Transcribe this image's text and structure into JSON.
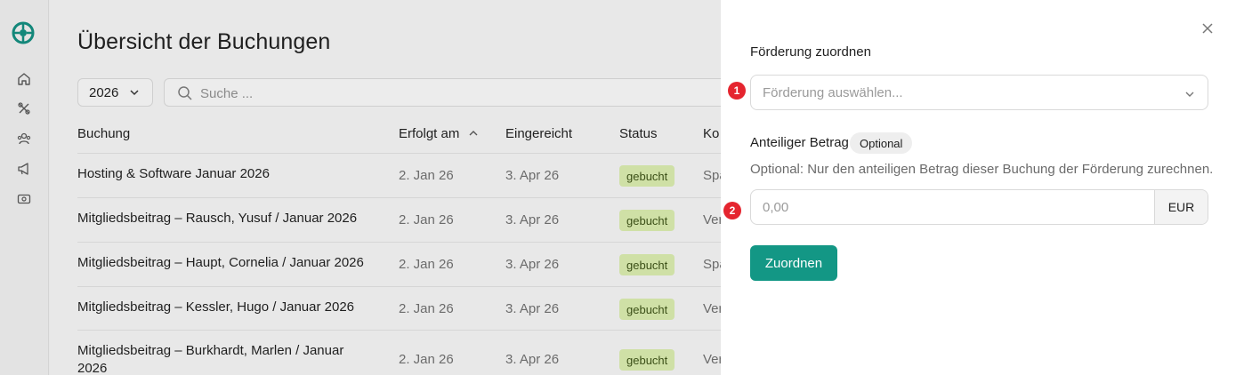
{
  "sidebar": {
    "logo_icon": "logo-icon",
    "items": [
      {
        "icon": "home-icon"
      },
      {
        "icon": "tools-icon"
      },
      {
        "icon": "users-icon"
      },
      {
        "icon": "megaphone-icon"
      },
      {
        "icon": "money-icon"
      }
    ]
  },
  "main": {
    "title": "Übersicht der Buchungen",
    "year_filter": "2026",
    "search_placeholder": "Suche ...",
    "columns": {
      "buchung": "Buchung",
      "erfolgt_am": "Erfolgt am",
      "eingereicht": "Eingereicht",
      "status": "Status",
      "konto": "Ko"
    },
    "rows": [
      {
        "title": "Hosting & Software Januar 2026",
        "erfolgt": "2. Jan 26",
        "eingereicht": "3. Apr 26",
        "status": "gebucht",
        "konto": "Spa"
      },
      {
        "title": "Mitgliedsbeitrag – Rausch, Yusuf / Januar 2026",
        "erfolgt": "2. Jan 26",
        "eingereicht": "3. Apr 26",
        "status": "gebucht",
        "konto": "Ver"
      },
      {
        "title": "Mitgliedsbeitrag – Haupt, Cornelia / Januar 2026",
        "erfolgt": "2. Jan 26",
        "eingereicht": "3. Apr 26",
        "status": "gebucht",
        "konto": "Spa"
      },
      {
        "title": "Mitgliedsbeitrag – Kessler, Hugo / Januar 2026",
        "erfolgt": "2. Jan 26",
        "eingereicht": "3. Apr 26",
        "status": "gebucht",
        "konto": "Ver"
      },
      {
        "title": "Mitgliedsbeitrag – Burkhardt, Marlen / Januar 2026",
        "erfolgt": "2. Jan 26",
        "eingereicht": "3. Apr 26",
        "status": "gebucht",
        "konto": "Ver"
      }
    ]
  },
  "drawer": {
    "heading": "Förderung zuordnen",
    "select_placeholder": "Förderung auswählen...",
    "amount_label": "Anteiliger Betrag",
    "optional_badge": "Optional",
    "hint": "Optional: Nur den anteiligen Betrag dieser Buchung der Förderung zurechnen.",
    "amount_placeholder": "0,00",
    "currency": "EUR",
    "submit": "Zuordnen",
    "step1": "1",
    "step2": "2"
  },
  "colors": {
    "accent": "#139785",
    "badge_bg": "#cfe0a6",
    "step_marker": "#e5252f"
  }
}
